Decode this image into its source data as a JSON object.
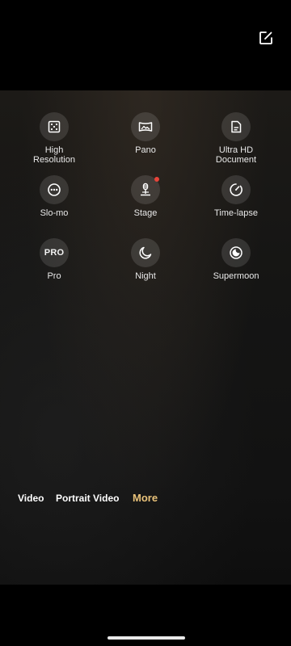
{
  "top": {
    "edit_icon": "edit-icon"
  },
  "modes": [
    {
      "label": "High\nResolution",
      "icon": "high-resolution-icon"
    },
    {
      "label": "Pano",
      "icon": "pano-icon"
    },
    {
      "label": "Ultra HD\nDocument",
      "icon": "document-icon"
    },
    {
      "label": "Slo-mo",
      "icon": "slo-mo-icon"
    },
    {
      "label": "Stage",
      "icon": "stage-icon",
      "badge": true
    },
    {
      "label": "Time-lapse",
      "icon": "time-lapse-icon"
    },
    {
      "label": "Pro",
      "icon_text": "PRO"
    },
    {
      "label": "Night",
      "icon": "night-icon"
    },
    {
      "label": "Supermoon",
      "icon": "supermoon-icon"
    }
  ],
  "bottom_tabs": [
    {
      "label": "Video"
    },
    {
      "label": "Portrait Video"
    },
    {
      "label": "More",
      "active": true
    }
  ],
  "colors": {
    "accent": "#e9c27a",
    "badge": "#e8443a"
  }
}
